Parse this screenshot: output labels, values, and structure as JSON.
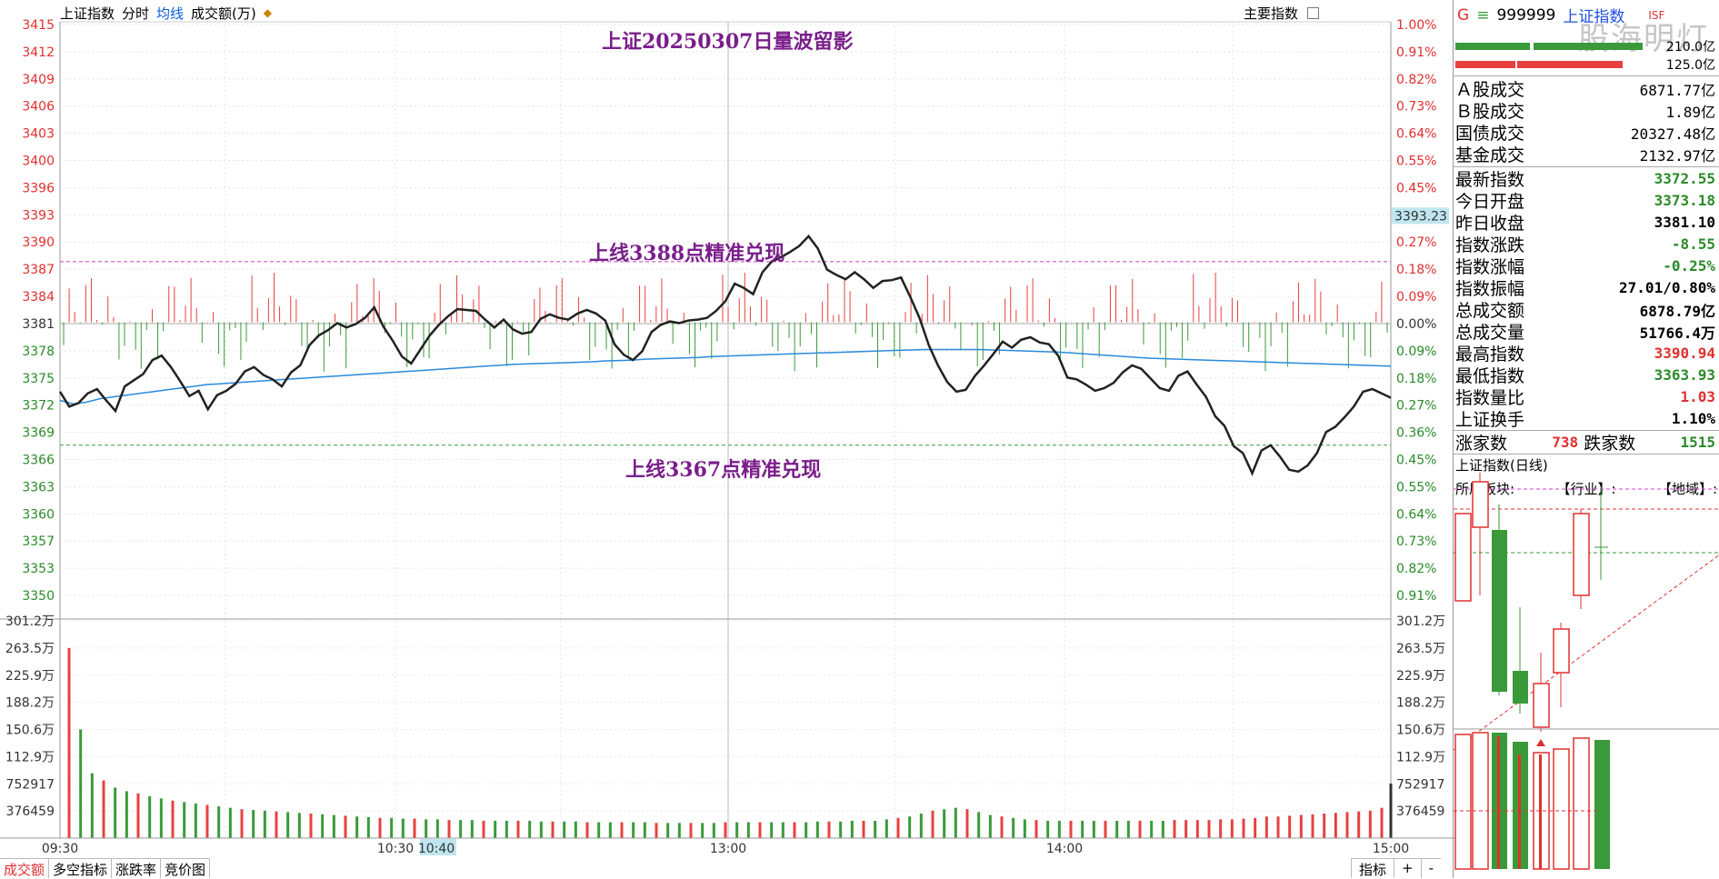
{
  "topbar": {
    "index_name": "上证指数",
    "tab_intraday": "分时",
    "tab_avg": "均线",
    "tab_volume": "成交额(万)",
    "main_index": "主要指数"
  },
  "chart_data": {
    "type": "line",
    "price_ticks": [
      "3415",
      "3412",
      "3409",
      "3406",
      "3403",
      "3400",
      "3396",
      "3393",
      "3390",
      "3387",
      "3384",
      "3381",
      "3378",
      "3375",
      "3372",
      "3369",
      "3366",
      "3363",
      "3360",
      "3357",
      "3353",
      "3350"
    ],
    "pct_ticks": [
      "1.00%",
      "0.91%",
      "0.82%",
      "0.73%",
      "0.64%",
      "0.55%",
      "0.45%",
      "0.36%",
      "0.27%",
      "0.18%",
      "0.09%",
      "0.00%",
      "0.09%",
      "0.18%",
      "0.27%",
      "0.36%",
      "0.45%",
      "0.55%",
      "0.64%",
      "0.73%",
      "0.82%",
      "0.91%"
    ],
    "volume_ticks": [
      "301.2万",
      "263.5万",
      "225.9万",
      "188.2万",
      "150.6万",
      "112.9万",
      "752917",
      "376459"
    ],
    "time_ticks": [
      "09:30",
      "10:30",
      "10:40",
      "13:00",
      "14:00",
      "15:00"
    ],
    "current_marker": "3393.23",
    "prev_close": 3381.1,
    "y_range": [
      3350,
      3415
    ],
    "price": [
      3373.2,
      3371.5,
      3371.9,
      3373.0,
      3373.5,
      3372.2,
      3371.0,
      3373.8,
      3374.5,
      3375.2,
      3376.8,
      3377.3,
      3376.0,
      3374.4,
      3372.7,
      3373.3,
      3371.2,
      3372.8,
      3373.3,
      3374.1,
      3375.5,
      3376.0,
      3375.1,
      3374.6,
      3373.8,
      3375.4,
      3376.2,
      3378.5,
      3379.6,
      3380.2,
      3381.0,
      3380.5,
      3380.9,
      3381.6,
      3382.8,
      3380.6,
      3379.0,
      3377.2,
      3376.4,
      3378.0,
      3379.6,
      3380.8,
      3381.8,
      3382.6,
      3382.5,
      3382.4,
      3381.4,
      3380.5,
      3381.4,
      3380.3,
      3379.8,
      3380.0,
      3381.5,
      3382.0,
      3381.6,
      3381.4,
      3382.1,
      3382.5,
      3382.1,
      3381.3,
      3378.6,
      3377.4,
      3376.8,
      3377.8,
      3380.0,
      3380.8,
      3381.2,
      3381.0,
      3381.3,
      3381.4,
      3381.6,
      3382.4,
      3383.5,
      3385.5,
      3385.0,
      3384.3,
      3386.8,
      3388.0,
      3388.5,
      3389.1,
      3389.8,
      3390.9,
      3389.5,
      3387.1,
      3386.5,
      3386.0,
      3386.8,
      3386.0,
      3385.0,
      3385.8,
      3385.9,
      3386.2,
      3384.0,
      3381.6,
      3378.5,
      3376.2,
      3374.3,
      3373.2,
      3373.4,
      3375.0,
      3376.2,
      3377.5,
      3378.9,
      3378.2,
      3379.1,
      3379.4,
      3378.8,
      3378.6,
      3377.3,
      3374.8,
      3374.6,
      3374.0,
      3373.3,
      3373.6,
      3374.2,
      3375.4,
      3376.2,
      3375.8,
      3374.7,
      3373.6,
      3373.3,
      3375.0,
      3375.5,
      3374.0,
      3372.6,
      3370.4,
      3369.3,
      3367.0,
      3366.2,
      3363.9,
      3366.5,
      3367.1,
      3365.8,
      3364.3,
      3364.1,
      3364.8,
      3366.2,
      3368.6,
      3369.2,
      3370.3,
      3371.5,
      3373.2,
      3373.5,
      3373.0,
      3372.5
    ],
    "avg": [
      3372.2,
      3371.8,
      3372.0,
      3372.4,
      3372.6,
      3372.8,
      3373.0,
      3373.2,
      3373.4,
      3373.6,
      3373.8,
      3374.0,
      3374.1,
      3374.2,
      3374.3,
      3374.4,
      3374.5,
      3374.6,
      3374.7,
      3374.8,
      3374.9,
      3375.0,
      3375.1,
      3375.2,
      3375.3,
      3375.4,
      3375.5,
      3375.6,
      3375.7,
      3375.8,
      3375.9,
      3376.0,
      3376.1,
      3376.2,
      3376.3,
      3376.35,
      3376.4,
      3376.45,
      3376.5,
      3376.55,
      3376.6,
      3376.7,
      3376.75,
      3376.8,
      3376.9,
      3376.95,
      3377.0,
      3377.05,
      3377.1,
      3377.2,
      3377.25,
      3377.3,
      3377.35,
      3377.4,
      3377.45,
      3377.5,
      3377.55,
      3377.6,
      3377.65,
      3377.7,
      3377.75,
      3377.8,
      3377.85,
      3377.9,
      3377.95,
      3378.0,
      3378.0,
      3378.0,
      3378.0,
      3378.0,
      3377.95,
      3377.9,
      3377.85,
      3377.8,
      3377.75,
      3377.7,
      3377.6,
      3377.5,
      3377.4,
      3377.3,
      3377.2,
      3377.1,
      3377.0,
      3376.95,
      3376.9,
      3376.85,
      3376.8,
      3376.75,
      3376.7,
      3376.65,
      3376.6,
      3376.55,
      3376.5,
      3376.45,
      3376.4,
      3376.35,
      3376.3,
      3376.25,
      3376.2,
      3376.15,
      3376.1
    ],
    "volume": [
      263.5,
      150.6,
      90,
      80,
      70,
      65,
      62,
      58,
      55,
      52,
      50,
      48,
      46,
      44,
      42,
      40,
      39,
      38,
      37,
      36,
      35,
      34,
      33,
      32,
      31,
      30,
      29,
      28,
      28,
      27,
      27,
      26,
      26,
      25,
      25,
      25,
      24,
      24,
      24,
      24,
      24,
      23,
      23,
      23,
      23,
      22,
      22,
      22,
      22,
      22,
      22,
      21,
      21,
      21,
      21,
      21,
      21,
      22,
      22,
      22,
      22,
      22,
      22,
      22,
      22,
      23,
      23,
      23,
      24,
      24,
      24,
      26,
      28,
      30,
      34,
      38,
      40,
      42,
      40,
      36,
      32,
      30,
      28,
      26,
      25,
      24,
      24,
      24,
      24,
      24,
      24,
      24,
      24,
      24,
      24,
      24,
      25,
      25,
      25,
      25,
      26,
      26,
      27,
      28,
      30,
      30,
      31,
      32,
      33,
      34,
      35,
      36,
      37,
      38,
      42
    ]
  },
  "notes": {
    "title": "上证20250307日量波留影",
    "upper_line": "上线3388点精准兑现",
    "lower_line": "上线3367点精准兑现"
  },
  "bottom_tabs": [
    "成交额",
    "多空指标",
    "涨跌率",
    "竞价图"
  ],
  "bottom_right": [
    "指标",
    "+",
    "-"
  ],
  "side": {
    "g": "G",
    "eq": "≡",
    "code": "999999",
    "name": "上证指数",
    "r": "ISF",
    "watermark": "股海明灯",
    "bar_top_label": "210.0亿",
    "bar_bottom_label": "125.0亿",
    "turnover": [
      {
        "k": "Ａ股成交",
        "v": "6871.77亿"
      },
      {
        "k": "Ｂ股成交",
        "v": "1.89亿"
      },
      {
        "k": "国债成交",
        "v": "20327.48亿"
      },
      {
        "k": "基金成交",
        "v": "2132.97亿"
      }
    ],
    "stats": [
      {
        "k": "最新指数",
        "v": "3372.55",
        "c": "green"
      },
      {
        "k": "今日开盘",
        "v": "3373.18",
        "c": "green"
      },
      {
        "k": "昨日收盘",
        "v": "3381.10",
        "c": "blk"
      },
      {
        "k": "指数涨跌",
        "v": "-8.55",
        "c": "green"
      },
      {
        "k": "指数涨幅",
        "v": "-0.25%",
        "c": "green"
      },
      {
        "k": "指数振幅",
        "v": "27.01/0.80%",
        "c": "blk"
      },
      {
        "k": "总成交额",
        "v": "6878.79亿",
        "c": "blk"
      },
      {
        "k": "总成交量",
        "v": "51766.4万",
        "c": "blk"
      },
      {
        "k": "最高指数",
        "v": "3390.94",
        "c": "red"
      },
      {
        "k": "最低指数",
        "v": "3363.93",
        "c": "green"
      },
      {
        "k": "指数量比",
        "v": "1.03",
        "c": "red"
      },
      {
        "k": "上证换手",
        "v": "1.10%",
        "c": "blk"
      }
    ],
    "up_label": "涨家数",
    "up_count": "738",
    "down_label": "跌家数",
    "down_count": "1515",
    "kline_title": "上证指数(日线)",
    "kline_sector": "所属板块:",
    "kline_industry": "【行业】:",
    "kline_region": "【地域】:"
  }
}
